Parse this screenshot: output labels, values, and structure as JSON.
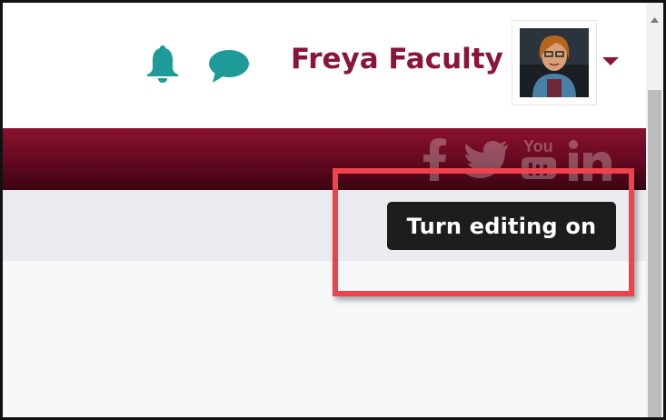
{
  "header": {
    "user_name": "Freya Faculty",
    "icons": [
      "bell-icon",
      "chat-icon",
      "chevron-down-icon"
    ]
  },
  "banner": {
    "social_icons": [
      "facebook-icon",
      "twitter-icon",
      "youtube-icon",
      "linkedin-icon"
    ],
    "youtube_label": "You"
  },
  "toolbar": {
    "edit_label": "Turn editing on"
  },
  "colors": {
    "brand_maroon": "#8a1538",
    "icon_teal": "#1e9a99",
    "banner_dark": "#3b0412",
    "highlight_red": "#f0424a",
    "button_bg": "#1d1d1d"
  }
}
